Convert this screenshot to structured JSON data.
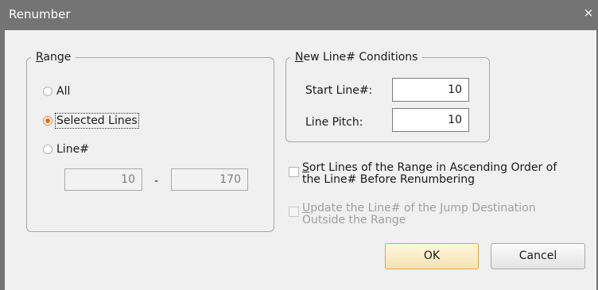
{
  "dialog": {
    "title": "Renumber",
    "close_glyph": "×"
  },
  "range": {
    "legend_u": "R",
    "legend_rest": "ange",
    "options": [
      {
        "label": "All",
        "selected": false
      },
      {
        "label": "Selected Lines",
        "selected": true
      },
      {
        "label": "Line#",
        "selected": false
      }
    ],
    "from_value": "10",
    "dash": "-",
    "to_value": "170"
  },
  "conditions": {
    "legend_u": "N",
    "legend_rest": "ew Line# Conditions",
    "start_label": "Start Line#:",
    "start_value": "10",
    "pitch_label": "Line Pitch:",
    "pitch_value": "10"
  },
  "options": {
    "sort": {
      "line1_u": "S",
      "line1_rest": "ort Lines of the Range in Ascending Order of",
      "line2": "the Line# Before Renumbering",
      "checked": false,
      "enabled": true
    },
    "update": {
      "line1_u": "U",
      "line1_rest": "pdate the Line# of the Jump Destination",
      "line2": "Outside the Range",
      "checked": false,
      "enabled": false
    }
  },
  "buttons": {
    "ok": "OK",
    "cancel": "Cancel"
  },
  "colors": {
    "titlebar": "#747474",
    "accent_radio": "#e36b12",
    "default_button_border": "#e0a53a"
  }
}
